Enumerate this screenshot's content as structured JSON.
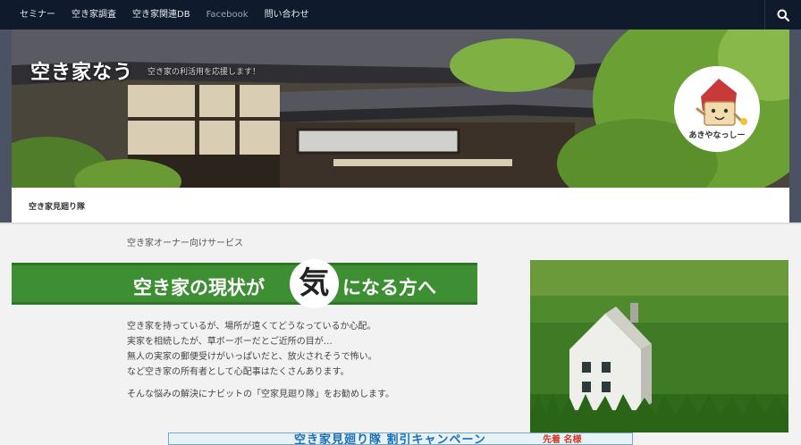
{
  "nav": {
    "items": [
      {
        "label": "セミナー"
      },
      {
        "label": "空き家調査"
      },
      {
        "label": "空き家関連DB"
      },
      {
        "label": "Facebook"
      },
      {
        "label": "問い合わせ"
      }
    ],
    "search_icon": "search-icon"
  },
  "header": {
    "site_title": "空き家なう",
    "tagline": "空き家の利活用を応援します！",
    "mascot_label": "あきやなっしー"
  },
  "breadcrumb": {
    "current": "空き家見廻り隊"
  },
  "main": {
    "service_label": "空き家オーナー向けサービス",
    "banner": {
      "text_before": "空き家の現状が",
      "circle_char": "気",
      "text_after": "になる方へ",
      "color": "#3e8f33"
    },
    "body_lines": [
      "空き家を持っているが、場所が遠くてどうなっているか心配。",
      "実家を相続したが、草ボーボーだとご近所の目が…",
      "無人の実家の郵便受けがいっぱいだと、放火されそうで怖い。",
      "など空き家の所有者として心配事はたくさんあります。"
    ],
    "recommend": "そんな悩みの解決にナビットの「空家見廻り隊」をお勧めします。",
    "campaign": {
      "title": "空き家見廻り隊 割引キャンペーン",
      "badge": "先着 名様"
    }
  }
}
